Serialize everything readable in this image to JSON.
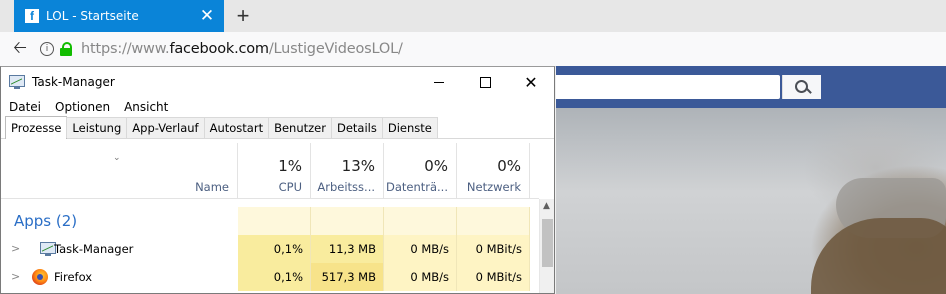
{
  "browser": {
    "tab_title": "LOL - Startseite",
    "tab_favicon": "f",
    "tab_close": "✕",
    "new_tab": "+",
    "url_prefix": "https://www.",
    "url_domain": "facebook.com",
    "url_path": "/LustigeVideosLOL/",
    "accent_color": "#0a84d8"
  },
  "taskmanager": {
    "title": "Task-Manager",
    "menu": [
      "Datei",
      "Optionen",
      "Ansicht"
    ],
    "tabs": [
      "Prozesse",
      "Leistung",
      "App-Verlauf",
      "Autostart",
      "Benutzer",
      "Details",
      "Dienste"
    ],
    "active_tab": "Prozesse",
    "columns": {
      "name": "Name",
      "cpu": {
        "pct": "1%",
        "label": "CPU"
      },
      "mem": {
        "pct": "13%",
        "label": "Arbeitss..."
      },
      "disk": {
        "pct": "0%",
        "label": "Datenträ..."
      },
      "net": {
        "pct": "0%",
        "label": "Netzwerk"
      }
    },
    "group": "Apps (2)",
    "processes": [
      {
        "name": "Task-Manager",
        "icon": "taskmanager-icon",
        "cpu": "0,1%",
        "mem": "11,3 MB",
        "disk": "0 MB/s",
        "net": "0 MBit/s"
      },
      {
        "name": "Firefox",
        "icon": "firefox-icon",
        "cpu": "0,1%",
        "mem": "517,3 MB",
        "disk": "0 MB/s",
        "net": "0 MBit/s"
      }
    ],
    "highlight_color": "#fff4c4"
  }
}
